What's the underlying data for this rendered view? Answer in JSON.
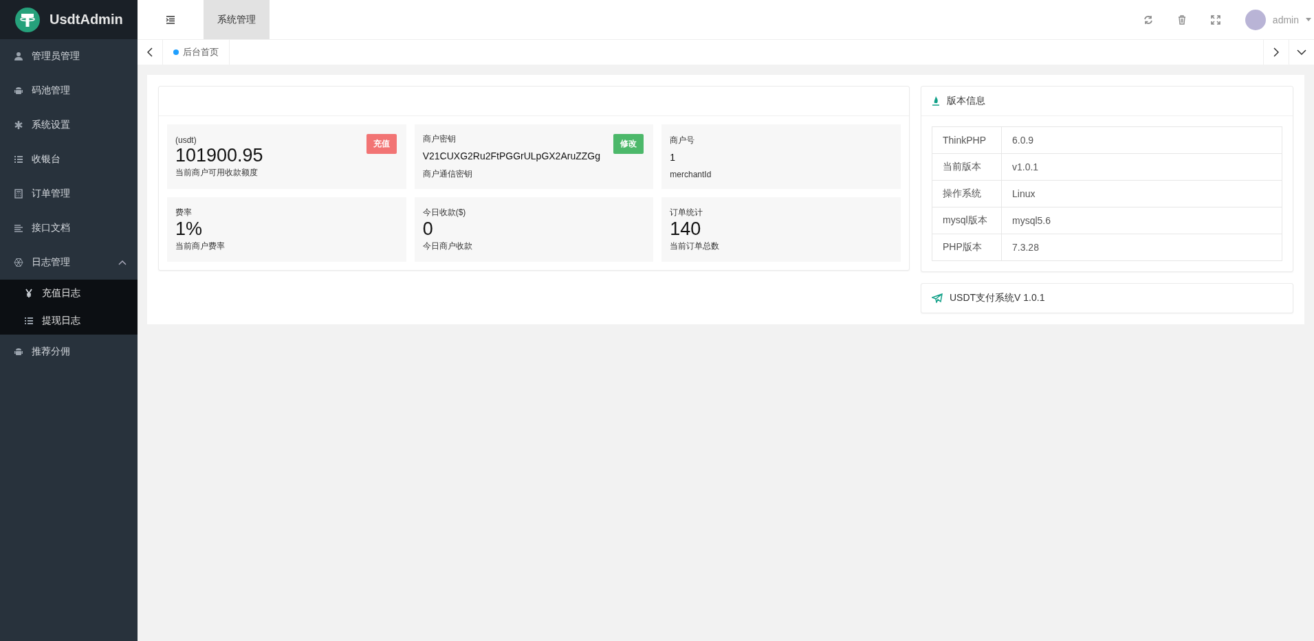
{
  "brand": {
    "title": "UsdtAdmin"
  },
  "header": {
    "module_tab": {
      "label": "系统管理",
      "selected": true
    },
    "user": "admin"
  },
  "page_tabs": [
    {
      "label": "后台首页",
      "selected": true
    }
  ],
  "sidebar": {
    "items": [
      {
        "label": "管理员管理"
      },
      {
        "label": "码池管理"
      },
      {
        "label": "系统设置"
      },
      {
        "label": "收银台"
      },
      {
        "label": "订单管理"
      },
      {
        "label": "接口文档"
      },
      {
        "label": "日志管理",
        "expanded": true,
        "children": [
          {
            "label": "充值日志"
          },
          {
            "label": "提现日志"
          }
        ]
      },
      {
        "label": "推荐分佣"
      }
    ]
  },
  "stats": [
    {
      "label": "(usdt)",
      "value": "101900.95",
      "kind": "big",
      "caption": "当前商户可用收款额度",
      "action": {
        "label": "充值",
        "color": "#f27474"
      }
    },
    {
      "label": "商户密钥",
      "value": "V21CUXG2Ru2FtPGGrULpGX2AruZZGg",
      "kind": "small",
      "caption": "商户通信密钥",
      "action": {
        "label": "修改",
        "color": "#4cb86a"
      }
    },
    {
      "label": "商户号",
      "value": "1",
      "kind": "small",
      "caption": "merchantId"
    },
    {
      "label": "费率",
      "value": "1%",
      "kind": "big",
      "caption": "当前商户费率"
    },
    {
      "label": "今日收款($)",
      "value": "0",
      "kind": "big",
      "caption": "今日商户收款"
    },
    {
      "label": "订单统计",
      "value": "140",
      "kind": "big",
      "caption": "当前订单总数"
    }
  ],
  "version_info": {
    "title": "版本信息",
    "rows": [
      [
        "ThinkPHP",
        "6.0.9"
      ],
      [
        "当前版本",
        "v1.0.1"
      ],
      [
        "操作系统",
        "Linux"
      ],
      [
        "mysql版本",
        "mysql5.6"
      ],
      [
        "PHP版本",
        "7.3.28"
      ]
    ]
  },
  "footer_card": {
    "text": "USDT支付系统V 1.0.1"
  }
}
